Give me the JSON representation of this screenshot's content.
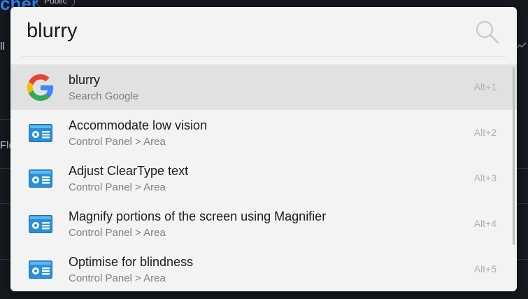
{
  "background": {
    "title_fragment": "cher",
    "badge": "Public",
    "left_fragment_1": "ll",
    "left_fragment_2": "Flo"
  },
  "launcher": {
    "query": "blurry",
    "results": [
      {
        "title": "blurry",
        "subtitle": "Search Google",
        "shortcut": "Alt+1",
        "icon": "google-icon",
        "selected": true
      },
      {
        "title": "Accommodate low vision",
        "subtitle": "Control Panel > Area",
        "shortcut": "Alt+2",
        "icon": "control-panel-icon",
        "selected": false
      },
      {
        "title": "Adjust ClearType text",
        "subtitle": "Control Panel > Area",
        "shortcut": "Alt+3",
        "icon": "control-panel-icon",
        "selected": false
      },
      {
        "title": "Magnify portions of the screen using Magnifier",
        "subtitle": "Control Panel > Area",
        "shortcut": "Alt+4",
        "icon": "control-panel-icon",
        "selected": false
      },
      {
        "title": "Optimise for blindness",
        "subtitle": "Control Panel > Area",
        "shortcut": "Alt+5",
        "icon": "control-panel-icon",
        "selected": false
      }
    ]
  },
  "colors": {
    "window_bg": "#f3f3f3",
    "selected_bg": "#e1e1e1",
    "page_bg": "#15181c",
    "accent": "#2f81f7"
  }
}
